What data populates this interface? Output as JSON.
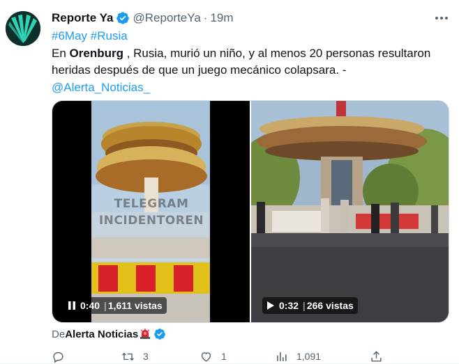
{
  "tweet": {
    "author_name": "Reporte Ya",
    "handle": "@ReporteYa",
    "separator": "·",
    "timestamp": "19m",
    "hashtag_1": "#6May",
    "hashtag_2": "#Rusia",
    "text_pre": "En ",
    "text_bold": "Orenburg",
    "text_main": " , Rusia, murió un niño, y al menos 20 personas resultaron heridas después de que un juego mecánico colapsara. -",
    "mention": "@Alerta_Noticias_"
  },
  "media": {
    "video_1": {
      "duration": "0:40",
      "views": "1,611 vistas",
      "watermark_line_1": "TELEGRAM",
      "watermark_line_2": "INCIDENTOREN",
      "control_icon": "pause-icon"
    },
    "video_2": {
      "duration": "0:32",
      "views": "266 vistas",
      "control_icon": "play-icon"
    }
  },
  "byline": {
    "prefix": "De",
    "source_name": "Alerta Noticias",
    "emoji": "siren-icon"
  },
  "actions": {
    "reply_count": "",
    "retweet_count": "3",
    "like_count": "1",
    "views_count": "1,091"
  },
  "colors": {
    "link": "#1d9bf0",
    "text": "#0f1419",
    "secondary": "#536471",
    "verified": "#1d9bf0"
  }
}
